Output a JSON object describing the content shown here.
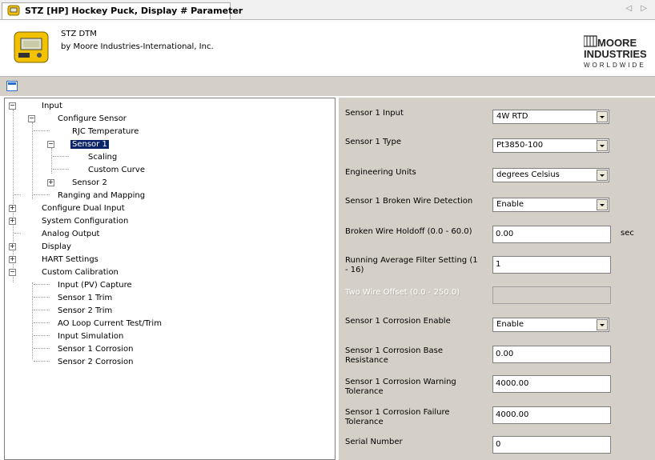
{
  "tab": {
    "title": "STZ [HP] Hockey Puck, Display # Parameter",
    "nav": "◁ ▷"
  },
  "header": {
    "dtm_name": "STZ DTM",
    "vendor": "by Moore Industries-International, Inc.",
    "logo_top": "MOORE",
    "logo_mid": "INDUSTRIES",
    "logo_bottom": "WORLDWIDE"
  },
  "tree": {
    "input": "Input",
    "configure_sensor": "Configure Sensor",
    "rjc_temperature": "RJC Temperature",
    "sensor1": "Sensor 1",
    "scaling": "Scaling",
    "custom_curve": "Custom Curve",
    "sensor2": "Sensor 2",
    "ranging_mapping": "Ranging and Mapping",
    "configure_dual_input": "Configure Dual Input",
    "system_configuration": "System Configuration",
    "analog_output": "Analog Output",
    "display": "Display",
    "hart_settings": "HART Settings",
    "custom_calibration": "Custom Calibration",
    "input_pv_capture": "Input (PV) Capture",
    "sensor1_trim": "Sensor 1 Trim",
    "sensor2_trim": "Sensor 2 Trim",
    "ao_loop": "AO Loop Current Test/Trim",
    "input_simulation": "Input Simulation",
    "sensor1_corrosion": "Sensor 1 Corrosion",
    "sensor2_corrosion": "Sensor 2 Corrosion"
  },
  "params": {
    "sensor1_input": {
      "label": "Sensor 1 Input",
      "value": "4W RTD"
    },
    "sensor1_type": {
      "label": "Sensor 1 Type",
      "value": "Pt3850-100"
    },
    "engineering_units": {
      "label": "Engineering Units",
      "value": "degrees Celsius"
    },
    "broken_wire_detection": {
      "label": "Sensor 1 Broken Wire Detection",
      "value": "Enable"
    },
    "broken_wire_holdoff": {
      "label": "Broken Wire Holdoff (0.0 - 60.0)",
      "value": "0.00",
      "unit": "sec"
    },
    "running_average": {
      "label": "Running Average Filter Setting (1 - 16)",
      "value": "1"
    },
    "two_wire_offset": {
      "label": "Two Wire Offset (0.0 - 250.0)",
      "value": ""
    },
    "corrosion_enable": {
      "label": "Sensor 1 Corrosion Enable",
      "value": "Enable"
    },
    "corrosion_base": {
      "label": "Sensor 1 Corrosion Base Resistance",
      "value": "0.00"
    },
    "corrosion_warning": {
      "label": "Sensor 1 Corrosion Warning Tolerance",
      "value": "4000.00"
    },
    "corrosion_failure": {
      "label": "Sensor 1 Corrosion Failure Tolerance",
      "value": "4000.00"
    },
    "serial_number": {
      "label": "Serial Number",
      "value": "0"
    }
  }
}
